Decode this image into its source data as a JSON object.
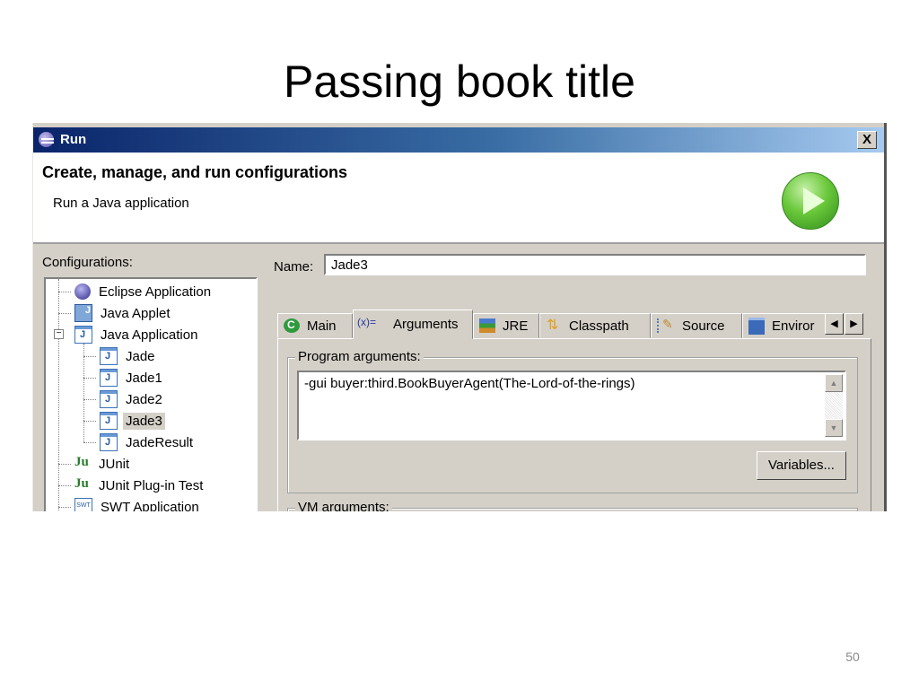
{
  "slide": {
    "title": "Passing book title",
    "page_number": "50"
  },
  "dialog": {
    "window_title": "Run",
    "close_label": "X",
    "header_title": "Create, manage, and run configurations",
    "header_subtitle": "Run a Java application",
    "configurations_label": "Configurations:",
    "tree": [
      {
        "label": "Eclipse Application",
        "icon": "eclipse-icon",
        "level": 0
      },
      {
        "label": "Java Applet",
        "icon": "java-applet-icon",
        "level": 0
      },
      {
        "label": "Java Application",
        "icon": "java-application-icon",
        "level": 0,
        "expanded": true
      },
      {
        "label": "Jade",
        "icon": "java-application-icon",
        "level": 1
      },
      {
        "label": "Jade1",
        "icon": "java-application-icon",
        "level": 1
      },
      {
        "label": "Jade2",
        "icon": "java-application-icon",
        "level": 1
      },
      {
        "label": "Jade3",
        "icon": "java-application-icon",
        "level": 1,
        "selected": true
      },
      {
        "label": "JadeResult",
        "icon": "java-application-icon",
        "level": 1
      },
      {
        "label": "JUnit",
        "icon": "junit-icon",
        "level": 0
      },
      {
        "label": "JUnit Plug-in Test",
        "icon": "junit-plugin-icon",
        "level": 0
      },
      {
        "label": "SWT Application",
        "icon": "swt-icon",
        "level": 0
      }
    ],
    "expander_symbol": "−",
    "name_label": "Name:",
    "name_value": "Jade3",
    "tabs": [
      {
        "label": "Main",
        "icon": "main-class-icon"
      },
      {
        "label": "Arguments",
        "icon": "arguments-icon",
        "active": true
      },
      {
        "label": "JRE",
        "icon": "jre-icon"
      },
      {
        "label": "Classpath",
        "icon": "classpath-icon"
      },
      {
        "label": "Source",
        "icon": "source-icon"
      },
      {
        "label": "Enviror",
        "icon": "environment-icon"
      }
    ],
    "tab_scroll_left": "◀",
    "tab_scroll_right": "▶",
    "program_arguments_label": "Program arguments:",
    "program_arguments_value": "-gui buyer:third.BookBuyerAgent(The-Lord-of-the-rings)",
    "scroll_up": "▲",
    "scroll_down": "▼",
    "variables_button": "Variables...",
    "vm_arguments_label": "VM arguments:"
  }
}
